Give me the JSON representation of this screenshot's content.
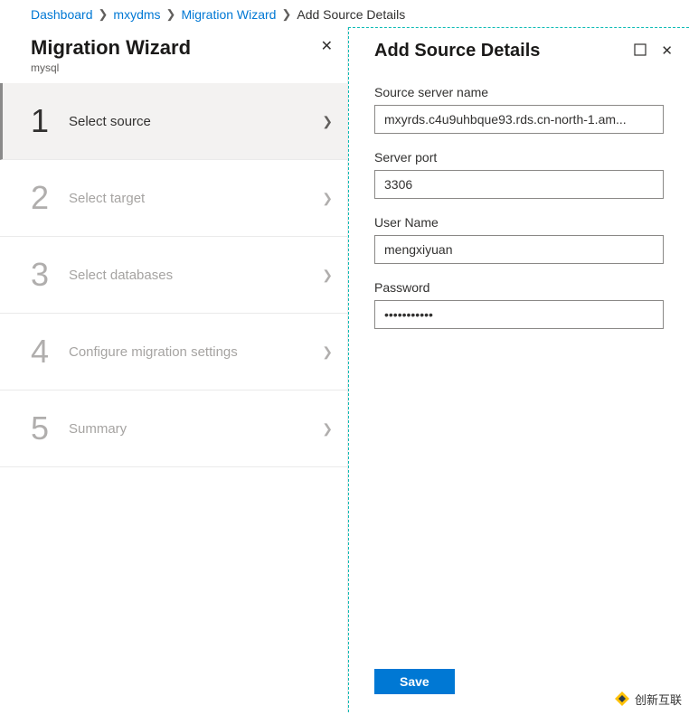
{
  "breadcrumb": {
    "items": [
      {
        "label": "Dashboard"
      },
      {
        "label": "mxydms"
      },
      {
        "label": "Migration Wizard"
      }
    ],
    "current": "Add Source Details"
  },
  "wizard": {
    "title": "Migration Wizard",
    "subtitle": "mysql",
    "steps": [
      {
        "num": "1",
        "label": "Select source",
        "active": true
      },
      {
        "num": "2",
        "label": "Select target",
        "active": false
      },
      {
        "num": "3",
        "label": "Select databases",
        "active": false
      },
      {
        "num": "4",
        "label": "Configure migration settings",
        "active": false
      },
      {
        "num": "5",
        "label": "Summary",
        "active": false
      }
    ]
  },
  "panel": {
    "title": "Add Source Details",
    "fields": {
      "source_server_label": "Source server name",
      "source_server_value": "mxyrds.c4u9uhbque93.rds.cn-north-1.am...",
      "port_label": "Server port",
      "port_value": "3306",
      "user_label": "User Name",
      "user_value": "mengxiyuan",
      "password_label": "Password",
      "password_value": "•••••••••••"
    },
    "save_label": "Save"
  },
  "watermark": "创新互联"
}
